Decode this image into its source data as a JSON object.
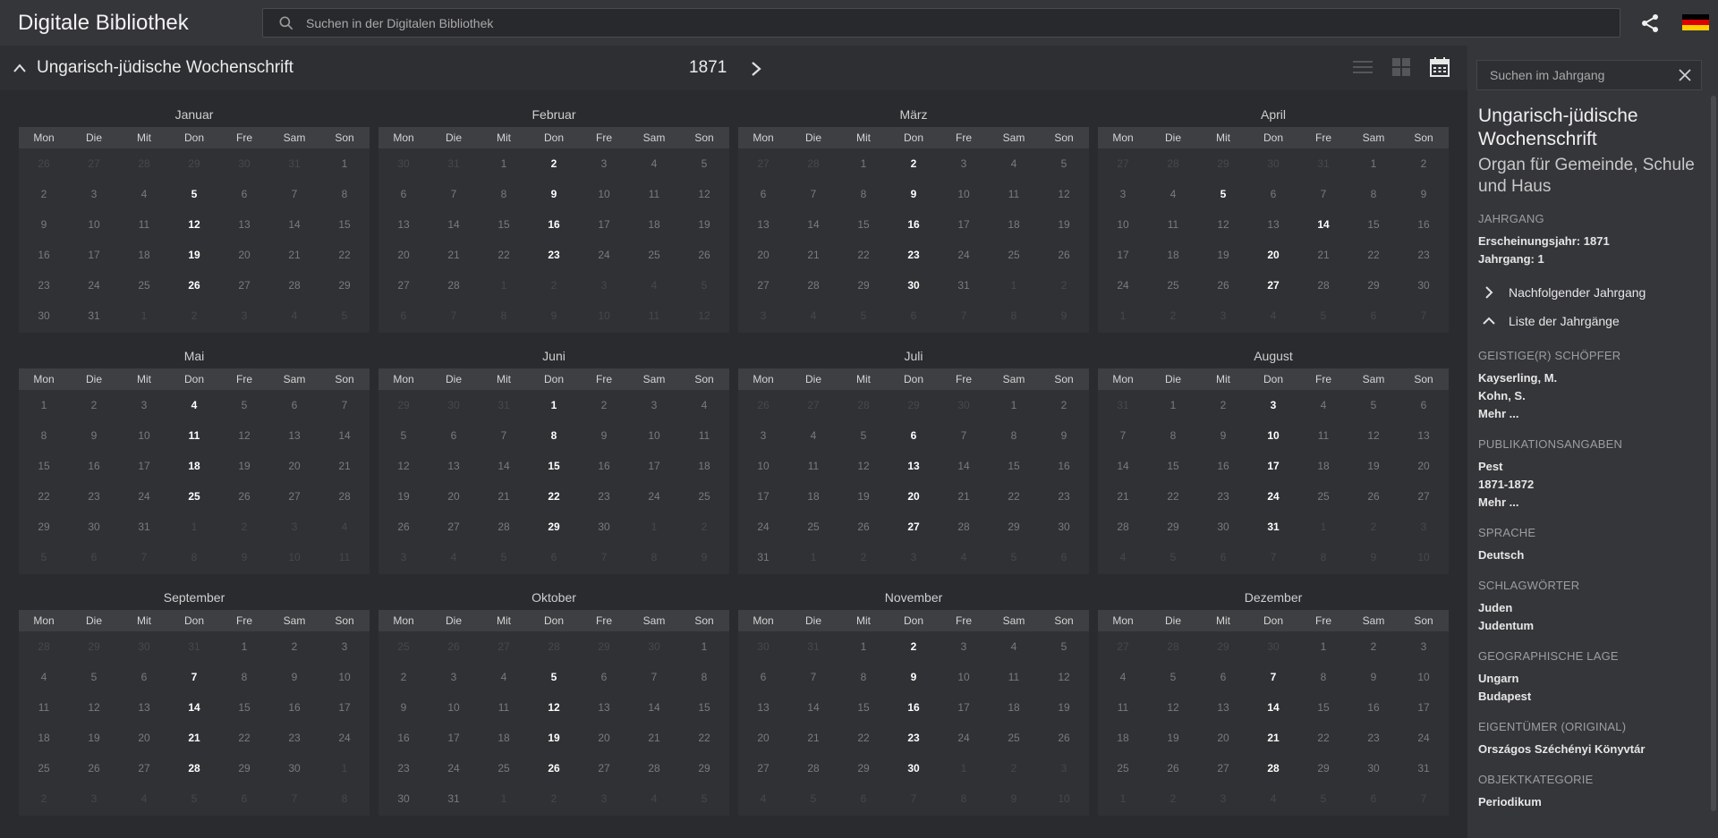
{
  "app": {
    "title": "Digitale Bibliothek",
    "search_placeholder": "Suchen in der Digitalen Bibliothek"
  },
  "header": {
    "series_title": "Ungarisch-jüdische Wochenschrift",
    "year": "1871"
  },
  "weekdays": [
    "Mon",
    "Die",
    "Mit",
    "Don",
    "Fre",
    "Sam",
    "Son"
  ],
  "months": [
    {
      "name": "Januar",
      "days": [
        "26",
        "27",
        "28",
        "29",
        "30",
        "31",
        "1",
        "2",
        "3",
        "4",
        "5",
        "6",
        "7",
        "8",
        "9",
        "10",
        "11",
        "12",
        "13",
        "14",
        "15",
        "16",
        "17",
        "18",
        "19",
        "20",
        "21",
        "22",
        "23",
        "24",
        "25",
        "26",
        "27",
        "28",
        "29",
        "30",
        "31",
        "1",
        "2",
        "3",
        "4",
        "5"
      ],
      "lead": 6,
      "count": 31,
      "issues": [
        "5",
        "12",
        "19",
        "26"
      ]
    },
    {
      "name": "Februar",
      "days": [
        "30",
        "31",
        "1",
        "2",
        "3",
        "4",
        "5",
        "6",
        "7",
        "8",
        "9",
        "10",
        "11",
        "12",
        "13",
        "14",
        "15",
        "16",
        "17",
        "18",
        "19",
        "20",
        "21",
        "22",
        "23",
        "24",
        "25",
        "26",
        "27",
        "28",
        "1",
        "2",
        "3",
        "4",
        "5",
        "6",
        "7",
        "8",
        "9",
        "10",
        "11",
        "12"
      ],
      "lead": 2,
      "count": 28,
      "issues": [
        "2",
        "9",
        "16",
        "23"
      ]
    },
    {
      "name": "März",
      "days": [
        "27",
        "28",
        "1",
        "2",
        "3",
        "4",
        "5",
        "6",
        "7",
        "8",
        "9",
        "10",
        "11",
        "12",
        "13",
        "14",
        "15",
        "16",
        "17",
        "18",
        "19",
        "20",
        "21",
        "22",
        "23",
        "24",
        "25",
        "26",
        "27",
        "28",
        "29",
        "30",
        "31",
        "1",
        "2",
        "3",
        "4",
        "5",
        "6",
        "7",
        "8",
        "9"
      ],
      "lead": 2,
      "count": 31,
      "issues": [
        "2",
        "9",
        "16",
        "23",
        "30"
      ]
    },
    {
      "name": "April",
      "days": [
        "27",
        "28",
        "29",
        "30",
        "31",
        "1",
        "2",
        "3",
        "4",
        "5",
        "6",
        "7",
        "8",
        "9",
        "10",
        "11",
        "12",
        "13",
        "14",
        "15",
        "16",
        "17",
        "18",
        "19",
        "20",
        "21",
        "22",
        "23",
        "24",
        "25",
        "26",
        "27",
        "28",
        "29",
        "30",
        "1",
        "2",
        "3",
        "4",
        "5",
        "6",
        "7"
      ],
      "lead": 5,
      "count": 30,
      "issues": [
        "5",
        "14",
        "20",
        "27"
      ]
    },
    {
      "name": "Mai",
      "days": [
        "1",
        "2",
        "3",
        "4",
        "5",
        "6",
        "7",
        "8",
        "9",
        "10",
        "11",
        "12",
        "13",
        "14",
        "15",
        "16",
        "17",
        "18",
        "19",
        "20",
        "21",
        "22",
        "23",
        "24",
        "25",
        "26",
        "27",
        "28",
        "29",
        "30",
        "31",
        "1",
        "2",
        "3",
        "4",
        "5",
        "6",
        "7",
        "8",
        "9",
        "10",
        "11"
      ],
      "lead": 0,
      "count": 31,
      "issues": [
        "4",
        "11",
        "18",
        "25"
      ]
    },
    {
      "name": "Juni",
      "days": [
        "29",
        "30",
        "31",
        "1",
        "2",
        "3",
        "4",
        "5",
        "6",
        "7",
        "8",
        "9",
        "10",
        "11",
        "12",
        "13",
        "14",
        "15",
        "16",
        "17",
        "18",
        "19",
        "20",
        "21",
        "22",
        "23",
        "24",
        "25",
        "26",
        "27",
        "28",
        "29",
        "30",
        "1",
        "2",
        "3",
        "4",
        "5",
        "6",
        "7",
        "8",
        "9"
      ],
      "lead": 3,
      "count": 30,
      "issues": [
        "1",
        "8",
        "15",
        "22",
        "29"
      ]
    },
    {
      "name": "Juli",
      "days": [
        "26",
        "27",
        "28",
        "29",
        "30",
        "1",
        "2",
        "3",
        "4",
        "5",
        "6",
        "7",
        "8",
        "9",
        "10",
        "11",
        "12",
        "13",
        "14",
        "15",
        "16",
        "17",
        "18",
        "19",
        "20",
        "21",
        "22",
        "23",
        "24",
        "25",
        "26",
        "27",
        "28",
        "29",
        "30",
        "31",
        "1",
        "2",
        "3",
        "4",
        "5",
        "6"
      ],
      "lead": 5,
      "count": 31,
      "issues": [
        "6",
        "13",
        "20",
        "27"
      ]
    },
    {
      "name": "August",
      "days": [
        "31",
        "1",
        "2",
        "3",
        "4",
        "5",
        "6",
        "7",
        "8",
        "9",
        "10",
        "11",
        "12",
        "13",
        "14",
        "15",
        "16",
        "17",
        "18",
        "19",
        "20",
        "21",
        "22",
        "23",
        "24",
        "25",
        "26",
        "27",
        "28",
        "29",
        "30",
        "31",
        "1",
        "2",
        "3",
        "4",
        "5",
        "6",
        "7",
        "8",
        "9",
        "10"
      ],
      "lead": 1,
      "count": 31,
      "issues": [
        "3",
        "10",
        "17",
        "24",
        "31"
      ]
    },
    {
      "name": "September",
      "days": [
        "28",
        "29",
        "30",
        "31",
        "1",
        "2",
        "3",
        "4",
        "5",
        "6",
        "7",
        "8",
        "9",
        "10",
        "11",
        "12",
        "13",
        "14",
        "15",
        "16",
        "17",
        "18",
        "19",
        "20",
        "21",
        "22",
        "23",
        "24",
        "25",
        "26",
        "27",
        "28",
        "29",
        "30",
        "1",
        "2",
        "3",
        "4",
        "5",
        "6",
        "7",
        "8"
      ],
      "lead": 4,
      "count": 30,
      "issues": [
        "7",
        "14",
        "21",
        "28"
      ]
    },
    {
      "name": "Oktober",
      "days": [
        "25",
        "26",
        "27",
        "28",
        "29",
        "30",
        "1",
        "2",
        "3",
        "4",
        "5",
        "6",
        "7",
        "8",
        "9",
        "10",
        "11",
        "12",
        "13",
        "14",
        "15",
        "16",
        "17",
        "18",
        "19",
        "20",
        "21",
        "22",
        "23",
        "24",
        "25",
        "26",
        "27",
        "28",
        "29",
        "30",
        "31",
        "1",
        "2",
        "3",
        "4",
        "5"
      ],
      "lead": 6,
      "count": 31,
      "issues": [
        "5",
        "12",
        "19",
        "26"
      ]
    },
    {
      "name": "November",
      "days": [
        "30",
        "31",
        "1",
        "2",
        "3",
        "4",
        "5",
        "6",
        "7",
        "8",
        "9",
        "10",
        "11",
        "12",
        "13",
        "14",
        "15",
        "16",
        "17",
        "18",
        "19",
        "20",
        "21",
        "22",
        "23",
        "24",
        "25",
        "26",
        "27",
        "28",
        "29",
        "30",
        "1",
        "2",
        "3",
        "4",
        "5",
        "6",
        "7",
        "8",
        "9",
        "10"
      ],
      "lead": 2,
      "count": 30,
      "issues": [
        "2",
        "9",
        "16",
        "23",
        "30"
      ]
    },
    {
      "name": "Dezember",
      "days": [
        "27",
        "28",
        "29",
        "30",
        "1",
        "2",
        "3",
        "4",
        "5",
        "6",
        "7",
        "8",
        "9",
        "10",
        "11",
        "12",
        "13",
        "14",
        "15",
        "16",
        "17",
        "18",
        "19",
        "20",
        "21",
        "22",
        "23",
        "24",
        "25",
        "26",
        "27",
        "28",
        "29",
        "30",
        "31",
        "1",
        "2",
        "3",
        "4",
        "5",
        "6",
        "7"
      ],
      "lead": 4,
      "count": 31,
      "issues": [
        "7",
        "14",
        "21",
        "28"
      ]
    }
  ],
  "sidebar": {
    "search_placeholder": "Suchen im Jahrgang",
    "title": "Ungarisch-jüdische Wochenschrift",
    "subtitle": "Organ für Gemeinde, Schule und Haus",
    "jahrgang_heading": "JAHRGANG",
    "erscheinungsjahr": "Erscheinungsjahr: 1871",
    "jahrgang": "Jahrgang: 1",
    "next_link": "Nachfolgender Jahrgang",
    "list_link": "Liste der Jahrgänge",
    "schoepfer_heading": "GEISTIGE(R) SCHÖPFER",
    "schoepfer": [
      "Kayserling, M.",
      "Kohn, S.",
      "Mehr ..."
    ],
    "publikation_heading": "PUBLIKATIONSANGABEN",
    "publikation": [
      "Pest",
      "1871-1872",
      "Mehr ..."
    ],
    "sprache_heading": "SPRACHE",
    "sprache": "Deutsch",
    "schlag_heading": "SCHLAGWÖRTER",
    "schlag": [
      "Juden",
      "Judentum"
    ],
    "geo_heading": "GEOGRAPHISCHE LAGE",
    "geo": [
      "Ungarn",
      "Budapest"
    ],
    "eigentuemer_heading": "EIGENTÜMER (ORIGINAL)",
    "eigentuemer": "Országos Széchényi Könyvtár",
    "kategorie_heading": "OBJEKTKATEGORIE",
    "kategorie": "Periodikum"
  },
  "colors": {
    "issue_day": "#ffffff",
    "normal_day": "#7a7b7f",
    "outside_day": "#47484c",
    "flag_black": "#000000",
    "flag_red": "#dd0000",
    "flag_gold": "#ffce00"
  }
}
